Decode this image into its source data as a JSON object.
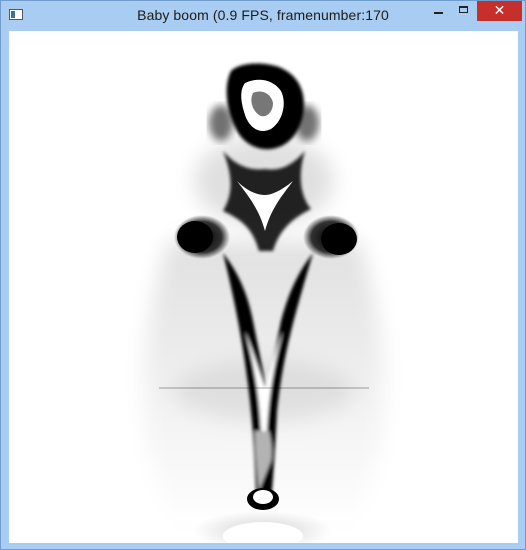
{
  "window": {
    "title": "Baby boom (0.9 FPS, framenumber:170",
    "minimize_glyph": "",
    "maximize_glyph": "",
    "close_glyph": "✕"
  },
  "icons": {
    "app": "window-app-icon",
    "minimize": "minimize-icon",
    "maximize": "maximize-icon",
    "close": "close-icon"
  },
  "colors": {
    "titlebar": "#a9cdf2",
    "close_button": "#c7302a",
    "canvas_background": "#ffffff",
    "ink": "#000000"
  }
}
